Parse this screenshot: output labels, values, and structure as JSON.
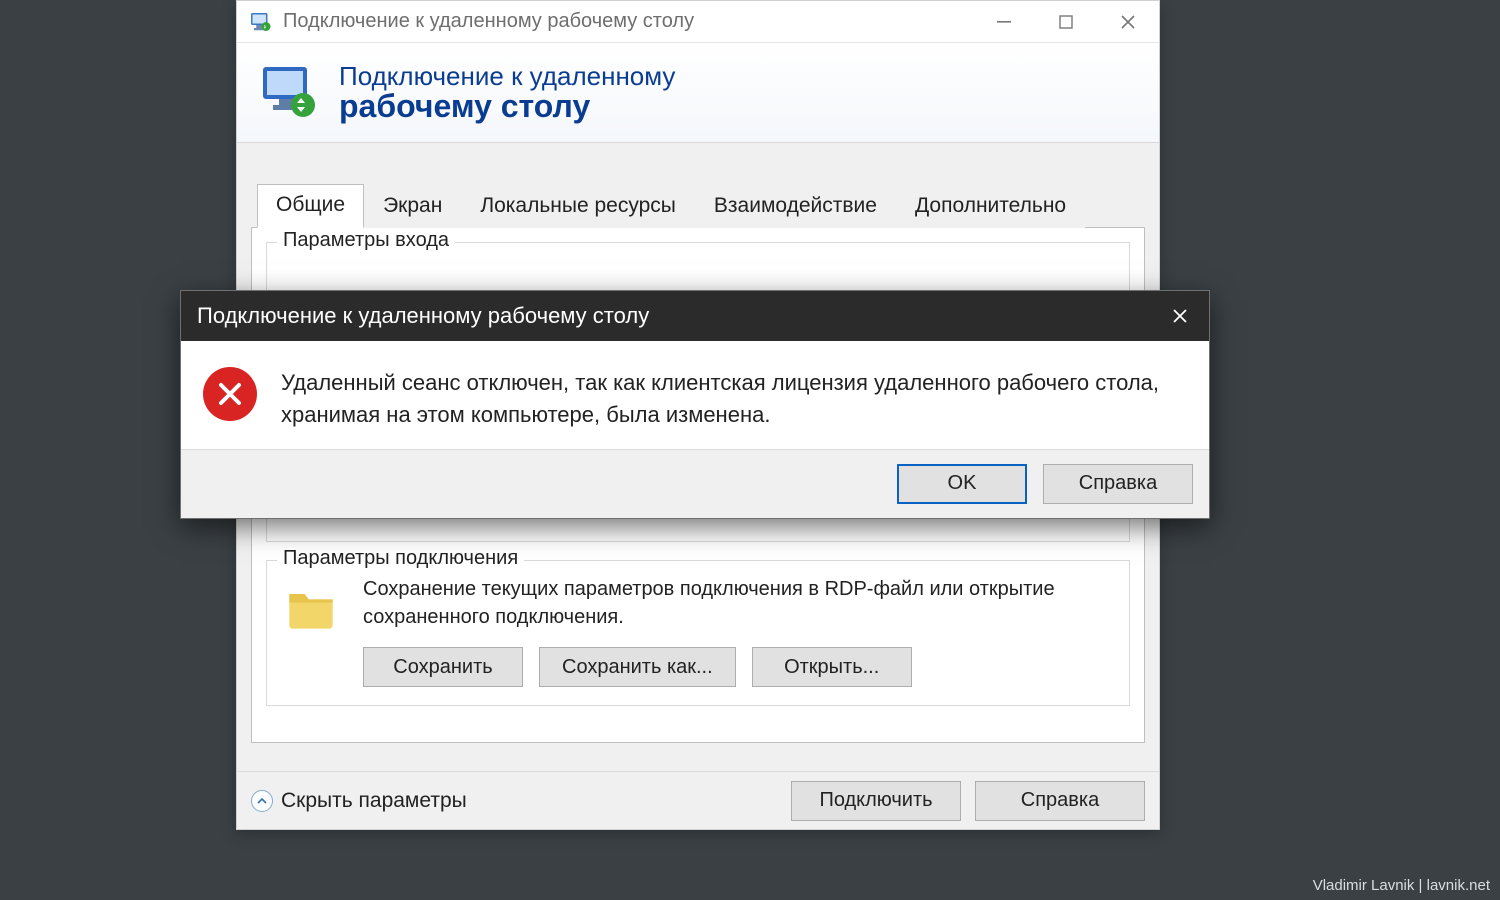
{
  "window": {
    "title": "Подключение к удаленному рабочему столу",
    "banner_line1": "Подключение к удаленному",
    "banner_line2": "рабочему столу"
  },
  "tabs": {
    "t0": "Общие",
    "t1": "Экран",
    "t2": "Локальные ресурсы",
    "t3": "Взаимодействие",
    "t4": "Дополнительно",
    "active_index": 0
  },
  "login_group": {
    "title": "Параметры входа"
  },
  "conn_group": {
    "title": "Параметры подключения",
    "desc": "Сохранение текущих параметров подключения в RDP-файл или открытие сохраненного подключения.",
    "save": "Сохранить",
    "save_as": "Сохранить как...",
    "open": "Открыть..."
  },
  "bottom": {
    "hide_params": "Скрыть параметры",
    "connect": "Подключить",
    "help": "Справка"
  },
  "dialog": {
    "title": "Подключение к удаленному рабочему столу",
    "message": "Удаленный сеанс отключен, так как клиентская лицензия удаленного рабочего стола, хранимая на этом компьютере, была изменена.",
    "ok": "OK",
    "help": "Справка"
  },
  "watermark": "Vladimir Lavnik | lavnik.net"
}
